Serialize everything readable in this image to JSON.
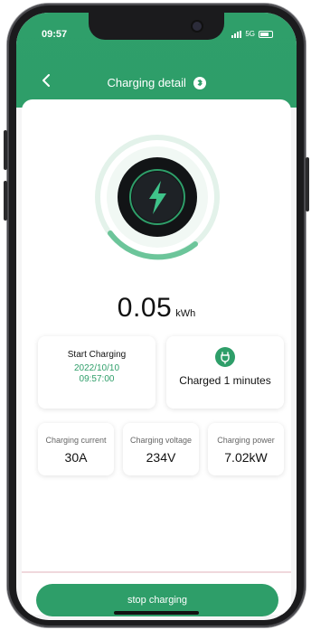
{
  "status_bar": {
    "time": "09:57",
    "network": "5G"
  },
  "header": {
    "title": "Charging detail"
  },
  "energy": {
    "value": "0.05",
    "unit": "kWh"
  },
  "start_card": {
    "label": "Start Charging",
    "date": "2022/10/10",
    "time": "09:57:00"
  },
  "charged_card": {
    "text": "Charged 1 minutes"
  },
  "metrics": [
    {
      "label": "Charging current",
      "value": "30A"
    },
    {
      "label": "Charging voltage",
      "value": "234V"
    },
    {
      "label": "Charging power",
      "value": "7.02kW"
    }
  ],
  "actions": {
    "stop_label": "stop charging"
  },
  "colors": {
    "accent": "#2e9e69",
    "ring_light": "#d9eee4"
  }
}
